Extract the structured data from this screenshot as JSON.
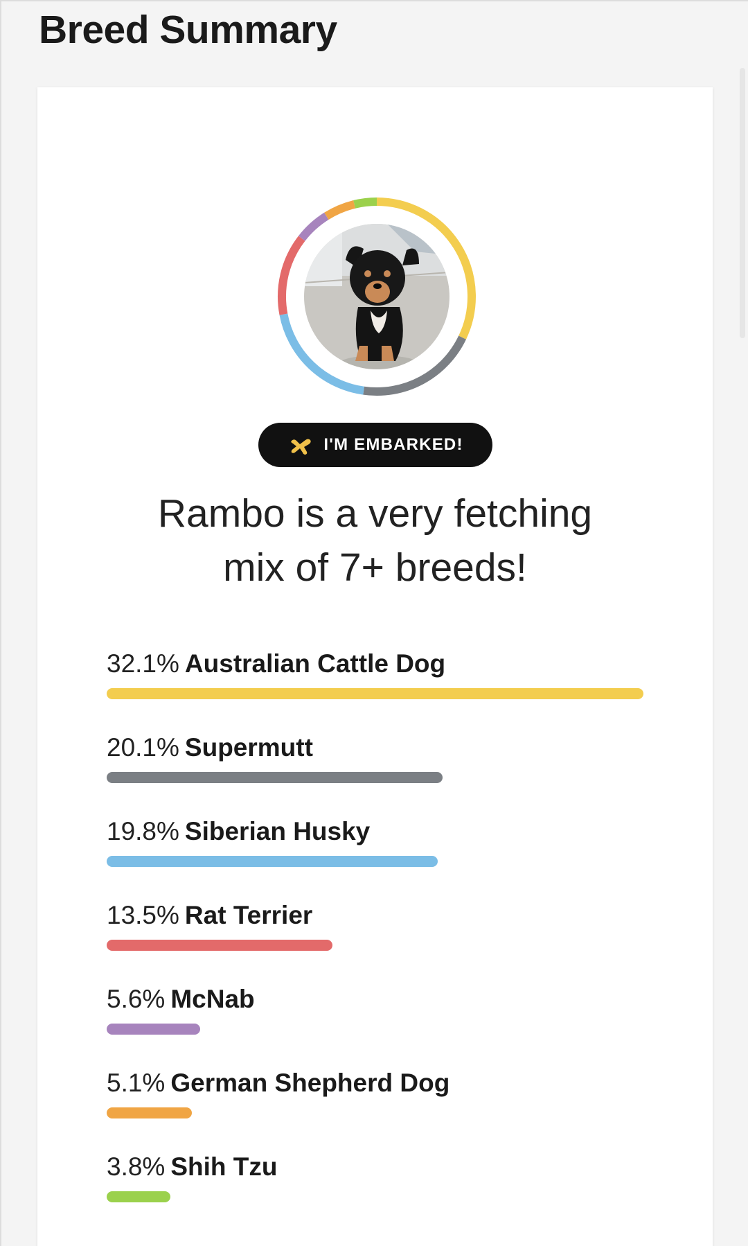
{
  "page": {
    "title": "Breed Summary"
  },
  "profile": {
    "badge_label": "I'M EMBARKED!",
    "badge_icon": "dog-balloon-icon",
    "headline_line1": "Rambo is a very fetching",
    "headline_line2": "mix of 7+ breeds!"
  },
  "breeds": [
    {
      "pct": "32.1%",
      "name": "Australian Cattle Dog",
      "value": 32.1,
      "color": "#f3cd4f"
    },
    {
      "pct": "20.1%",
      "name": "Supermutt",
      "value": 20.1,
      "color": "#7b7f84"
    },
    {
      "pct": "19.8%",
      "name": "Siberian Husky",
      "value": 19.8,
      "color": "#7bbde6"
    },
    {
      "pct": "13.5%",
      "name": "Rat Terrier",
      "value": 13.5,
      "color": "#e36a6a"
    },
    {
      "pct": "5.6%",
      "name": "McNab",
      "value": 5.6,
      "color": "#a784bd"
    },
    {
      "pct": "5.1%",
      "name": "German Shepherd Dog",
      "value": 5.1,
      "color": "#f0a544"
    },
    {
      "pct": "3.8%",
      "name": "Shih Tzu",
      "value": 3.8,
      "color": "#9bd14c"
    }
  ]
}
